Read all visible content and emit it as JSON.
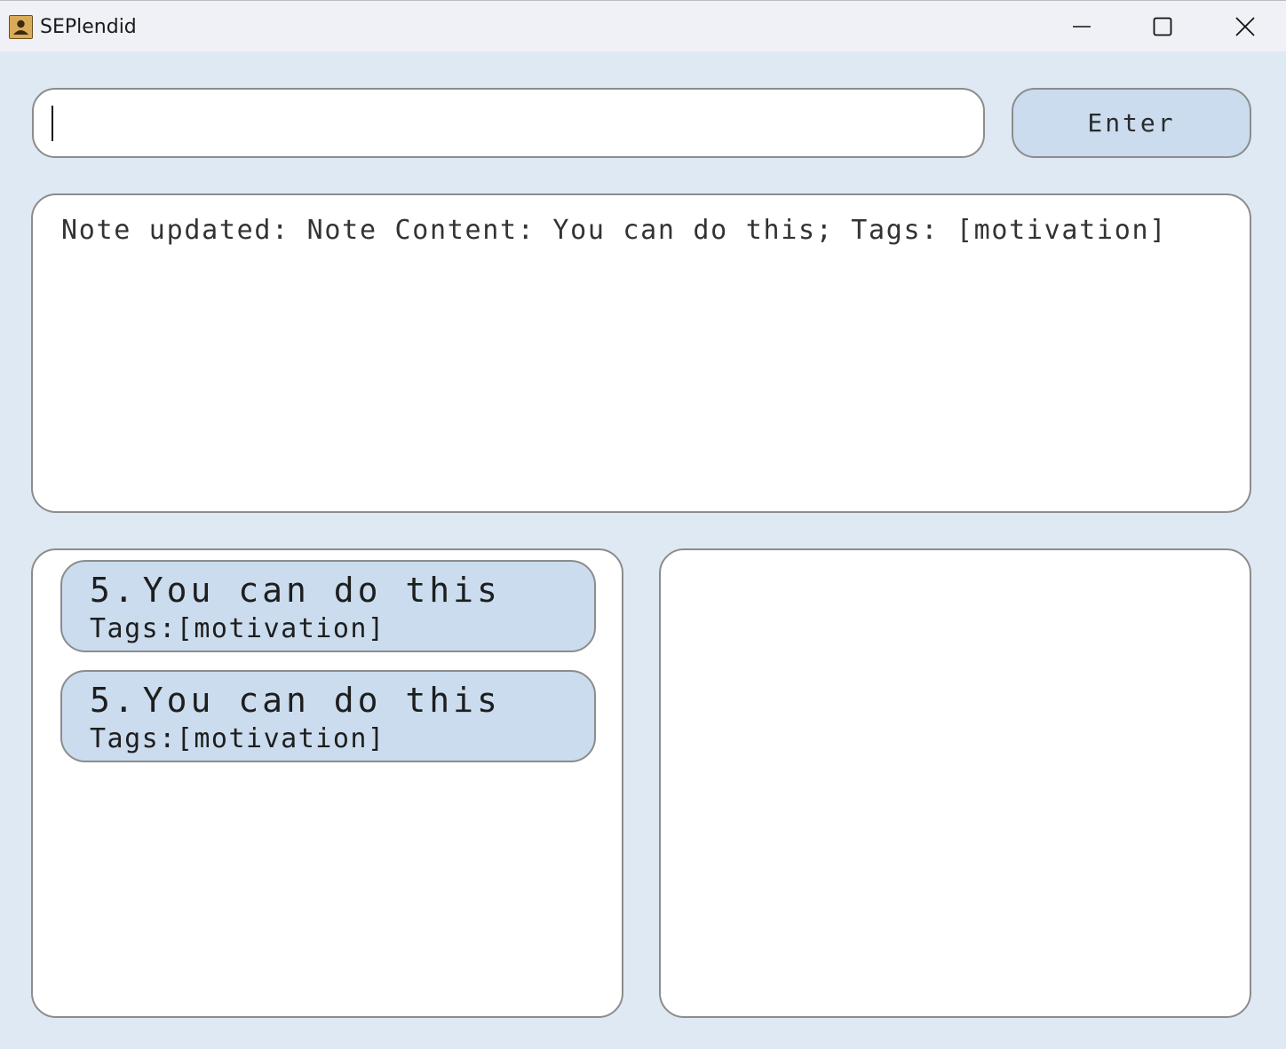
{
  "window": {
    "title": "SEPlendid",
    "icon": "contact-card-icon",
    "controls": [
      "minimize-icon",
      "maximize-icon",
      "close-icon"
    ]
  },
  "command": {
    "value": "",
    "placeholder": "",
    "enter_label": "Enter"
  },
  "result": {
    "message": "Note updated: Note Content: You can do this; Tags: [motivation]"
  },
  "notes": [
    {
      "index": "5.",
      "content": "You can do this",
      "tags": "Tags:[motivation]"
    },
    {
      "index": "5.",
      "content": "You can do this",
      "tags": "Tags:[motivation]"
    }
  ],
  "detail": {},
  "colors": {
    "background": "#dfe9f4",
    "card": "#cadcee",
    "border": "#8c8c8c",
    "titlebar": "#f0f1f7"
  }
}
